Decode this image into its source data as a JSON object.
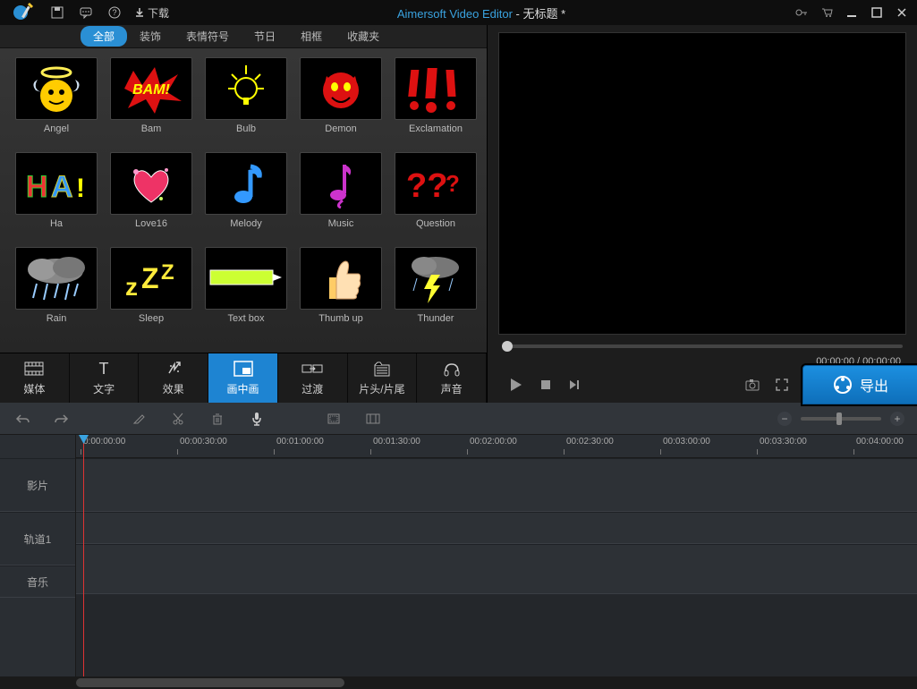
{
  "titlebar": {
    "download": "下载",
    "app_name": "Aimersoft Video Editor",
    "doc_title": " - 无标题 *"
  },
  "categories": [
    "全部",
    "装饰",
    "表情符号",
    "节日",
    "相框",
    "收藏夹"
  ],
  "active_category": 0,
  "effects": [
    {
      "label": "Angel"
    },
    {
      "label": "Bam"
    },
    {
      "label": "Bulb"
    },
    {
      "label": "Demon"
    },
    {
      "label": "Exclamation"
    },
    {
      "label": "Ha"
    },
    {
      "label": "Love16"
    },
    {
      "label": "Melody"
    },
    {
      "label": "Music"
    },
    {
      "label": "Question"
    },
    {
      "label": "Rain"
    },
    {
      "label": "Sleep"
    },
    {
      "label": "Text box"
    },
    {
      "label": "Thumb up"
    },
    {
      "label": "Thunder"
    }
  ],
  "modules": [
    {
      "label": "媒体"
    },
    {
      "label": "文字"
    },
    {
      "label": "效果"
    },
    {
      "label": "画中画"
    },
    {
      "label": "过渡"
    },
    {
      "label": "片头/片尾"
    },
    {
      "label": "声音"
    }
  ],
  "active_module": 3,
  "preview": {
    "time": "00:00:00 / 00:00:00"
  },
  "export_label": "导出",
  "timeline": {
    "ticks": [
      "0:00:00:00",
      "00:00:30:00",
      "00:01:00:00",
      "00:01:30:00",
      "00:02:00:00",
      "00:02:30:00",
      "00:03:00:00",
      "00:03:30:00",
      "00:04:00:00"
    ],
    "tracks": [
      "影片",
      "轨道1",
      "音乐"
    ]
  }
}
